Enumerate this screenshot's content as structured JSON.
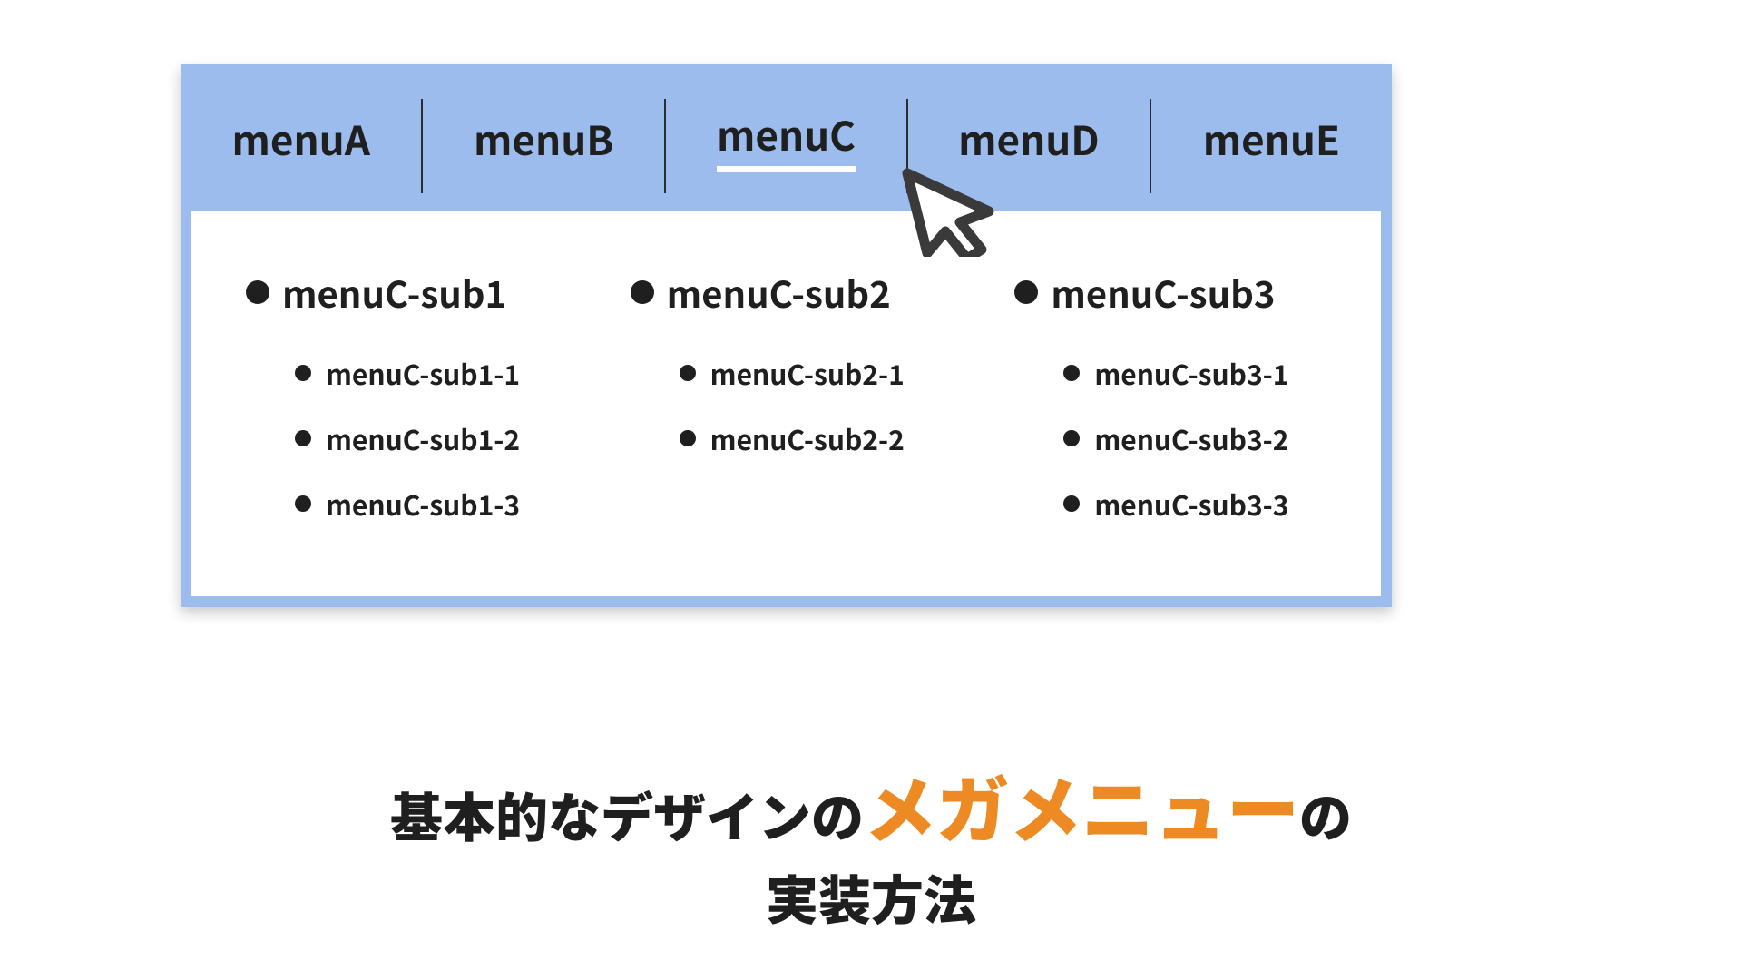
{
  "nav": {
    "items": [
      "menuA",
      "menuB",
      "menuC",
      "menuD",
      "menuE"
    ],
    "active_index": 2
  },
  "dropdown": {
    "columns": [
      {
        "title": "menuC-sub1",
        "items": [
          "menuC-sub1-1",
          "menuC-sub1-2",
          "menuC-sub1-3"
        ]
      },
      {
        "title": "menuC-sub2",
        "items": [
          "menuC-sub2-1",
          "menuC-sub2-2"
        ]
      },
      {
        "title": "menuC-sub3",
        "items": [
          "menuC-sub3-1",
          "menuC-sub3-2",
          "menuC-sub3-3"
        ]
      }
    ]
  },
  "caption": {
    "pre": "基本的なデザインの",
    "em": "メガメニュー",
    "post1": "の",
    "post2": "実装方法"
  },
  "colors": {
    "navbar_bg": "#9cbcee",
    "accent": "#ed8a23"
  }
}
